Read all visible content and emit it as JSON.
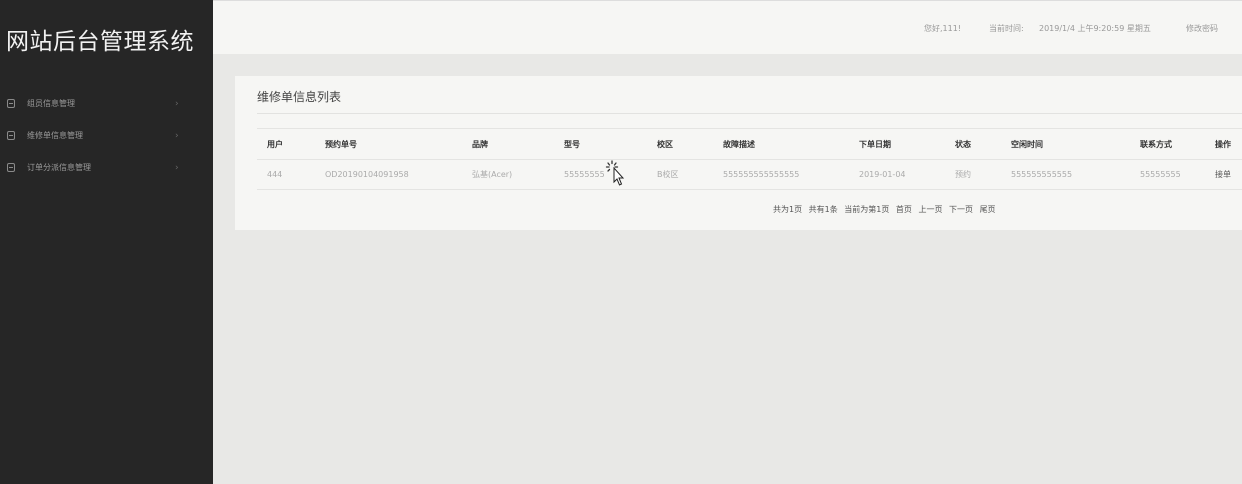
{
  "sidebar": {
    "brand": "网站后台管理系统",
    "items": [
      {
        "label": "组员信息管理",
        "icon": "list-icon"
      },
      {
        "label": "维修单信息管理",
        "icon": "list-icon"
      },
      {
        "label": "订单分派信息管理",
        "icon": "list-icon"
      }
    ],
    "arrow": "›"
  },
  "topbar": {
    "greeting": "您好,111!",
    "time_label": "当前时间:",
    "time_value": "2019/1/4 上午9:20:59 星期五",
    "change_password": "修改密码"
  },
  "panel": {
    "title": "维修单信息列表",
    "columns": [
      "用户",
      "预约单号",
      "品牌",
      "型号",
      "校区",
      "故障描述",
      "下单日期",
      "状态",
      "空闲时间",
      "联系方式",
      "操作"
    ],
    "rows": [
      [
        "444",
        "OD20190104091958",
        "弘基(Acer)",
        "55555555",
        "B校区",
        "555555555555555",
        "2019-01-04",
        "预约",
        "555555555555",
        "55555555",
        "接单"
      ]
    ]
  },
  "pager": {
    "total_pages": "共为1页",
    "total_records": "共有1条",
    "current": "当前为第1页",
    "first": "首页",
    "prev": "上一页",
    "next": "下一页",
    "last": "尾页"
  }
}
